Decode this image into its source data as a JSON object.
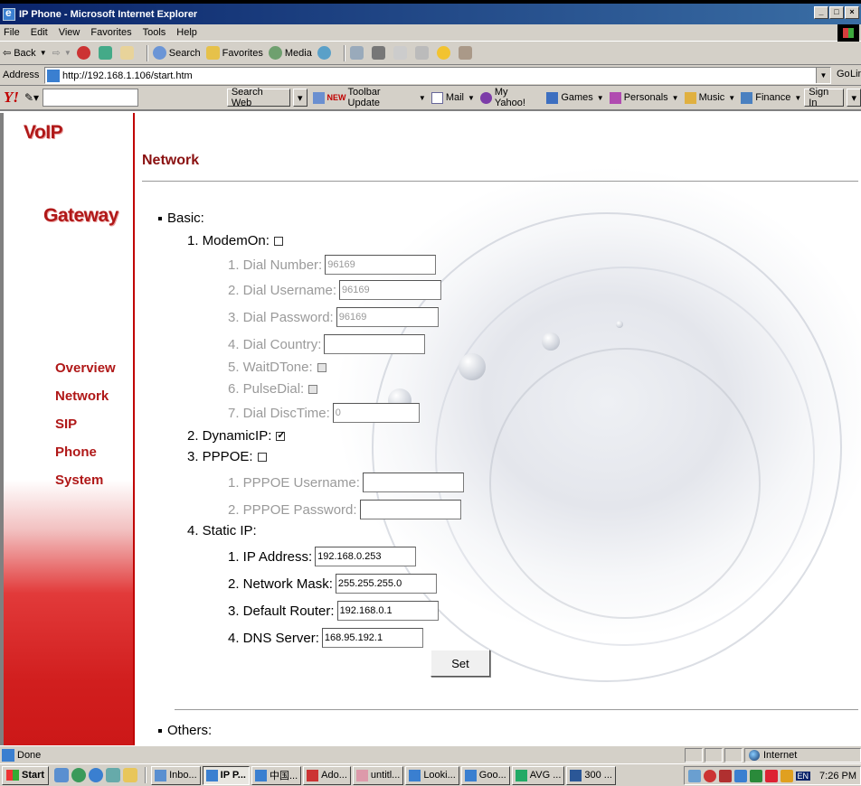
{
  "window": {
    "title": "IP Phone - Microsoft Internet Explorer",
    "controls": [
      "_",
      "□",
      "×"
    ]
  },
  "menu": [
    "File",
    "Edit",
    "View",
    "Favorites",
    "Tools",
    "Help"
  ],
  "toolbar": {
    "back": "Back",
    "search": "Search",
    "favorites": "Favorites",
    "media": "Media"
  },
  "address": {
    "label": "Address",
    "url": "http://192.168.1.106/start.htm",
    "go": "Go",
    "links": "Lin"
  },
  "yahoo": {
    "logo": "Y!",
    "search_btn": "Search Web",
    "new_badge": "NEW",
    "toolbar_update": "Toolbar Update",
    "mail": "Mail",
    "my_yahoo": "My Yahoo!",
    "games": "Games",
    "personals": "Personals",
    "music": "Music",
    "finance": "Finance",
    "sign_in": "Sign In"
  },
  "sidebar": {
    "logo_line1": "VoIP",
    "logo_line2": "Gateway",
    "nav": [
      "Overview",
      "Network",
      "SIP",
      "Phone",
      "System"
    ]
  },
  "page": {
    "title": "Network",
    "basic_label": "Basic:",
    "others_label": "Others:",
    "set_button": "Set",
    "modem_on": "1.  ModemOn:",
    "dial_number": {
      "label": "1.  Dial Number:",
      "value": "96169"
    },
    "dial_username": {
      "label": "2.  Dial Username:",
      "value": "96169"
    },
    "dial_password": {
      "label": "3.  Dial Password:",
      "value": "96169"
    },
    "dial_country": {
      "label": "4.  Dial Country:",
      "value": ""
    },
    "wait_dtone": "5.  WaitDTone:",
    "pulse_dial": "6.  PulseDial:",
    "dial_disc_time": {
      "label": "7.  Dial DiscTime:",
      "value": "0"
    },
    "dynamic_ip": "2.  DynamicIP:",
    "pppoe": "3.  PPPOE:",
    "pppoe_username": {
      "label": "1.  PPPOE Username:",
      "value": ""
    },
    "pppoe_password": {
      "label": "2.  PPPOE Password:",
      "value": ""
    },
    "static_ip": "4.  Static IP:",
    "ip_address": {
      "label": "1.  IP Address:",
      "value": "192.168.0.253"
    },
    "network_mask": {
      "label": "2.  Network Mask:",
      "value": "255.255.255.0"
    },
    "default_router": {
      "label": "3.  Default Router:",
      "value": "192.168.0.1"
    },
    "dns_server": {
      "label": "4.  DNS Server:",
      "value": "168.95.192.1"
    }
  },
  "status": {
    "text": "Done",
    "zone": "Internet"
  },
  "taskbar": {
    "start": "Start",
    "items": [
      "Inbo...",
      "IP P...",
      "中国...",
      "Ado...",
      "untitl...",
      "Looki...",
      "Goo...",
      "AVG ...",
      "300 ..."
    ],
    "lang": "EN",
    "clock": "7:26 PM"
  },
  "colors": {
    "brand_red": "#b01818",
    "title_bar": "#0a246a",
    "chrome": "#d4d0c8"
  }
}
